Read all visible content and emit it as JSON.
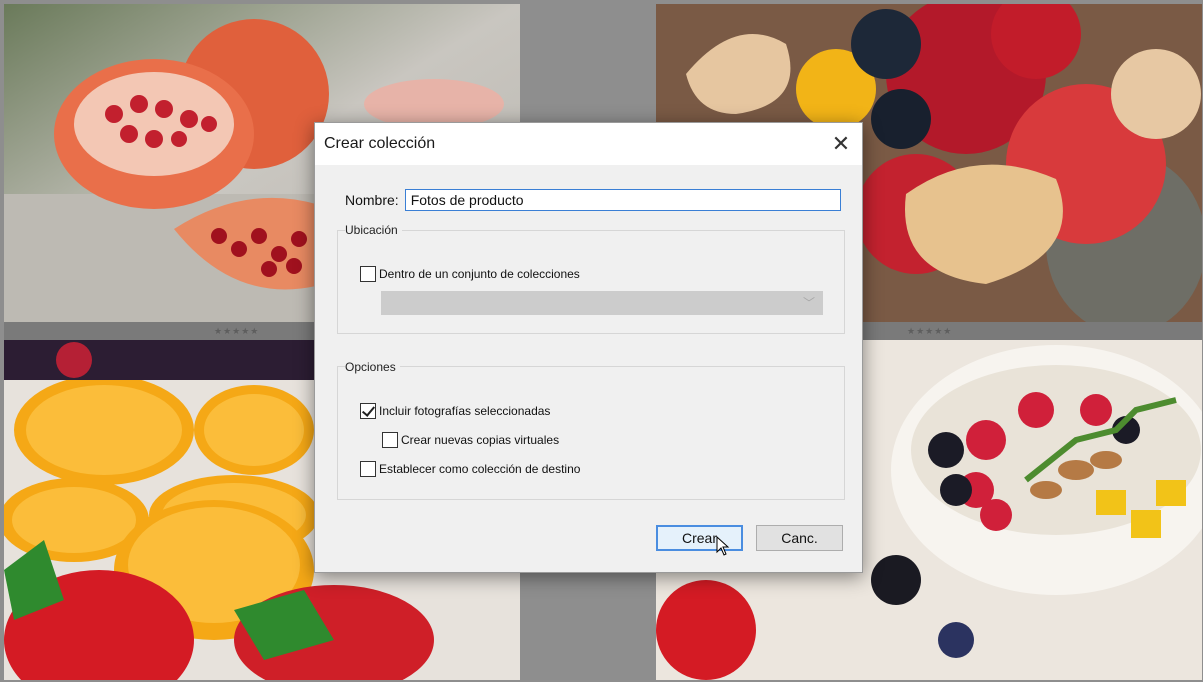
{
  "background": {
    "thumbnails": [
      {
        "name": "pomegranate-photo",
        "subject": "pomegranate"
      },
      {
        "name": "fruit-bowl-photo",
        "subject": "fruit bowl with physalis and apples"
      },
      {
        "name": "orange-strawberry-photo",
        "subject": "orange slices and strawberries"
      },
      {
        "name": "yogurt-bowl-photo",
        "subject": "bowl with berries, almonds and mango"
      }
    ],
    "rating_left": "★★★★★",
    "rating_right": "★★★★★"
  },
  "dialog": {
    "title": "Crear colección",
    "close_icon": "close-icon",
    "name_label": "Nombre:",
    "name_value": "Fotos de producto",
    "location_group": "Ubicación",
    "inside_set_label": "Dentro de un conjunto de colecciones",
    "inside_set_checked": false,
    "options_group": "Opciones",
    "include_selected_label": "Incluir fotografías seleccionadas",
    "include_selected_checked": true,
    "virtual_copies_label": "Crear nuevas copias virtuales",
    "virtual_copies_checked": false,
    "target_collection_label": "Establecer como colección de destino",
    "target_collection_checked": false,
    "create_button": "Crear",
    "cancel_button": "Canc."
  },
  "colors": {
    "accent": "#3a7fd5",
    "dialog_bg": "#f0f0f0",
    "titlebar_bg": "#ffffff"
  }
}
